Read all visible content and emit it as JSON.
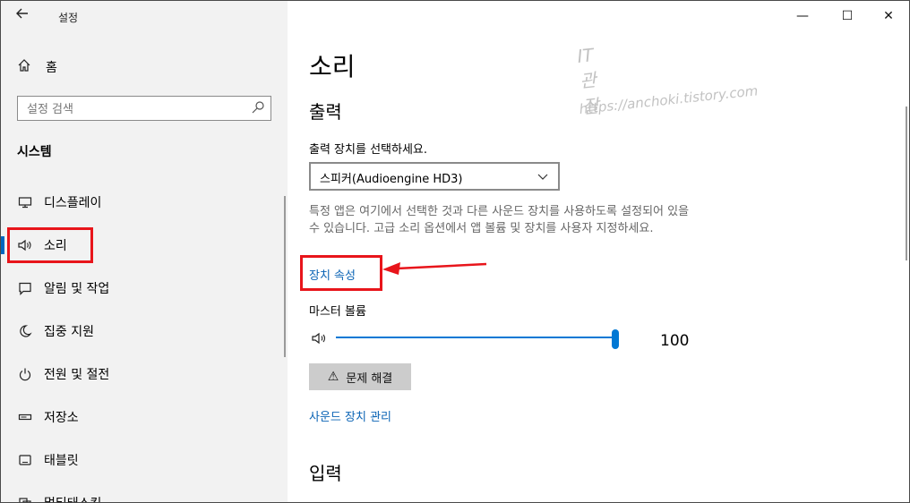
{
  "window": {
    "title": "설정",
    "controls": {
      "minimize": "—",
      "maximize": "☐",
      "close": "✕"
    }
  },
  "sidebar": {
    "home_label": "홈",
    "search": {
      "placeholder": "설정 검색",
      "value": ""
    },
    "section_title": "시스템",
    "items": [
      {
        "label": "디스플레이",
        "icon": "monitor-icon",
        "active": false
      },
      {
        "label": "소리",
        "icon": "speaker-icon",
        "active": true
      },
      {
        "label": "알림 및 작업",
        "icon": "notification-icon",
        "active": false
      },
      {
        "label": "집중 지원",
        "icon": "moon-icon",
        "active": false
      },
      {
        "label": "전원 및 절전",
        "icon": "power-icon",
        "active": false
      },
      {
        "label": "저장소",
        "icon": "storage-icon",
        "active": false
      },
      {
        "label": "태블릿",
        "icon": "tablet-icon",
        "active": false
      },
      {
        "label": "멀티태스킹",
        "icon": "multitasking-icon",
        "active": false
      }
    ]
  },
  "main": {
    "page_title": "소리",
    "output_heading": "출력",
    "output_device_label": "출력 장치를 선택하세요.",
    "output_device_value": "스피커(Audioengine HD3)",
    "description": "특정 앱은 여기에서 선택한 것과 다른 사운드 장치를 사용하도록 설정되어 있을 수 있습니다. 고급 소리 옵션에서 앱 볼륨 및 장치를 사용자 지정하세요.",
    "device_properties_link": "장치 속성",
    "master_volume_label": "마스터 볼륨",
    "volume_value": "100",
    "volume_fraction": 1.0,
    "troubleshoot_button": "문제 해결",
    "manage_devices_link": "사운드 장치 관리",
    "input_heading": "입력",
    "watermark": {
      "line1": "IT관잘",
      "line2": "https://anchoki.tistory.com"
    }
  },
  "colors": {
    "accent": "#0078d4",
    "link": "#0b64b5",
    "highlight_red": "#e8151b",
    "sidebar_bg": "#f2f2f2"
  }
}
